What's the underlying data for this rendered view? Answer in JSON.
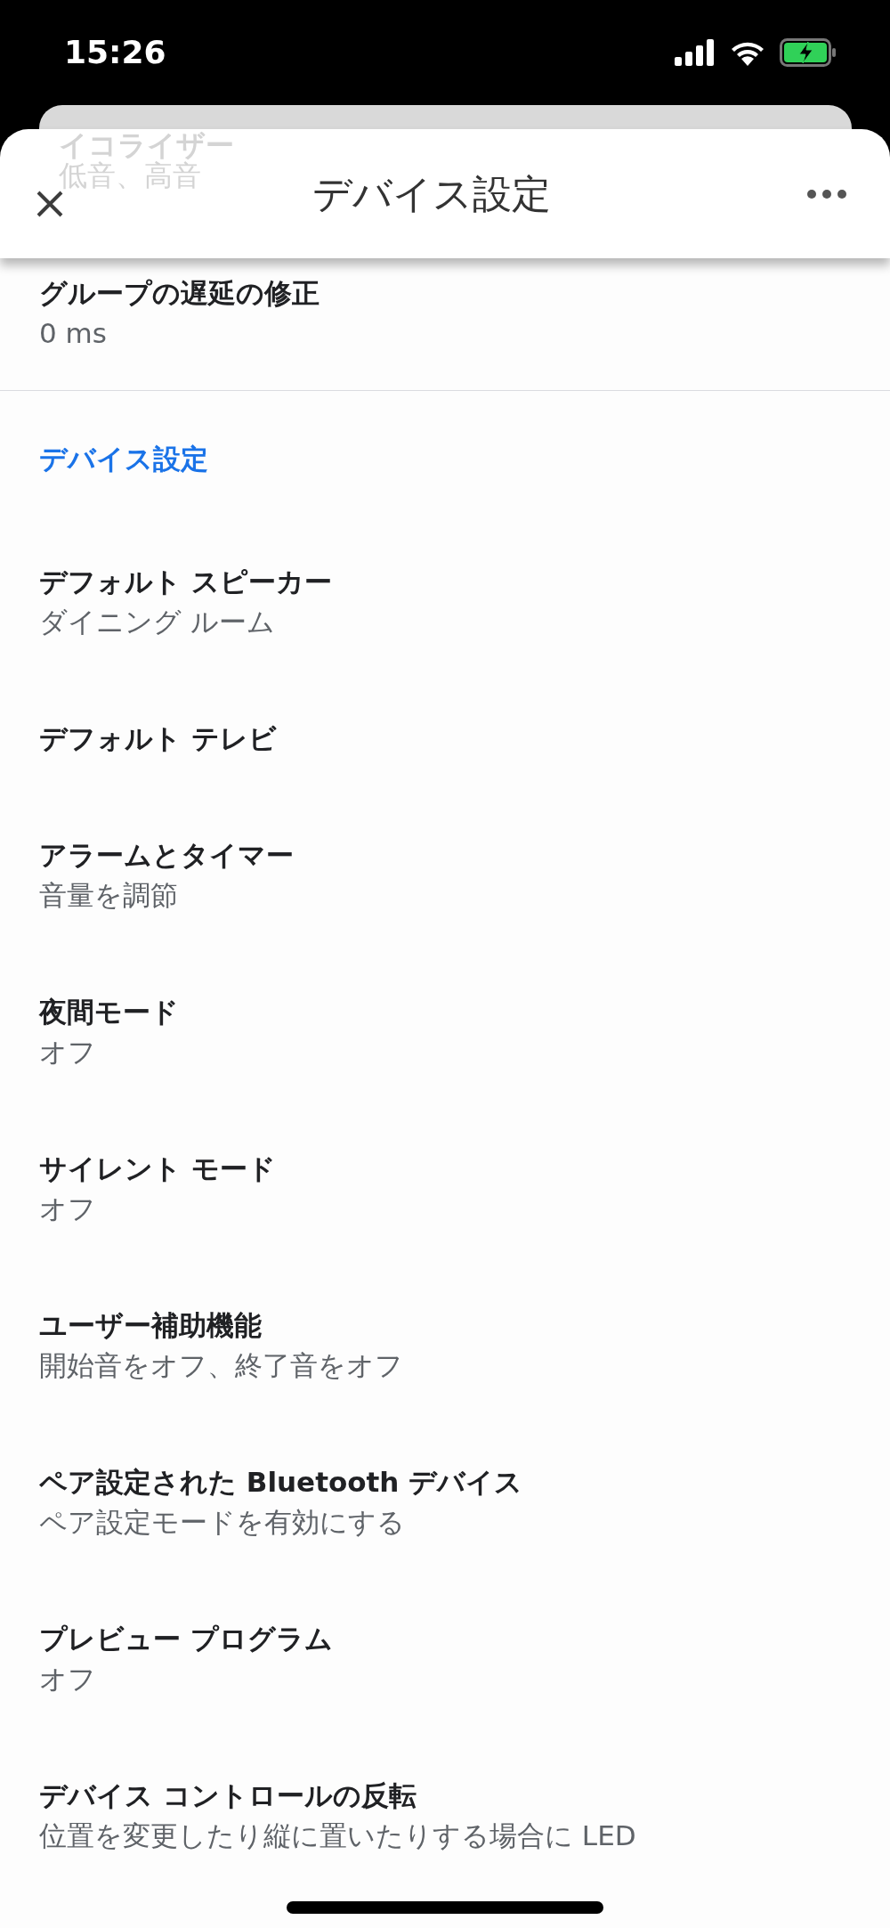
{
  "status_bar": {
    "time": "15:26"
  },
  "background_card": {
    "title": "イコライザー",
    "subtitle": "低音、高音"
  },
  "header": {
    "title": "デバイス設定"
  },
  "top_setting": {
    "title": "グループの遅延の修正",
    "subtitle": "0 ms"
  },
  "section": {
    "title": "デバイス設定",
    "items": [
      {
        "title": "デフォルト スピーカー",
        "subtitle": "ダイニング ルーム"
      },
      {
        "title": "デフォルト テレビ"
      },
      {
        "title": "アラームとタイマー",
        "subtitle": "音量を調節"
      },
      {
        "title": "夜間モード",
        "subtitle": "オフ"
      },
      {
        "title": "サイレント モード",
        "subtitle": "オフ"
      },
      {
        "title": "ユーザー補助機能",
        "subtitle": "開始音をオフ、終了音をオフ"
      },
      {
        "title": "ペア設定された Bluetooth デバイス",
        "subtitle": "ペア設定モードを有効にする"
      },
      {
        "title": "プレビュー プログラム",
        "subtitle": "オフ"
      },
      {
        "title": "デバイス コントロールの反転",
        "subtitle": "位置を変更したり縦に置いたりする場合に LED"
      }
    ]
  }
}
